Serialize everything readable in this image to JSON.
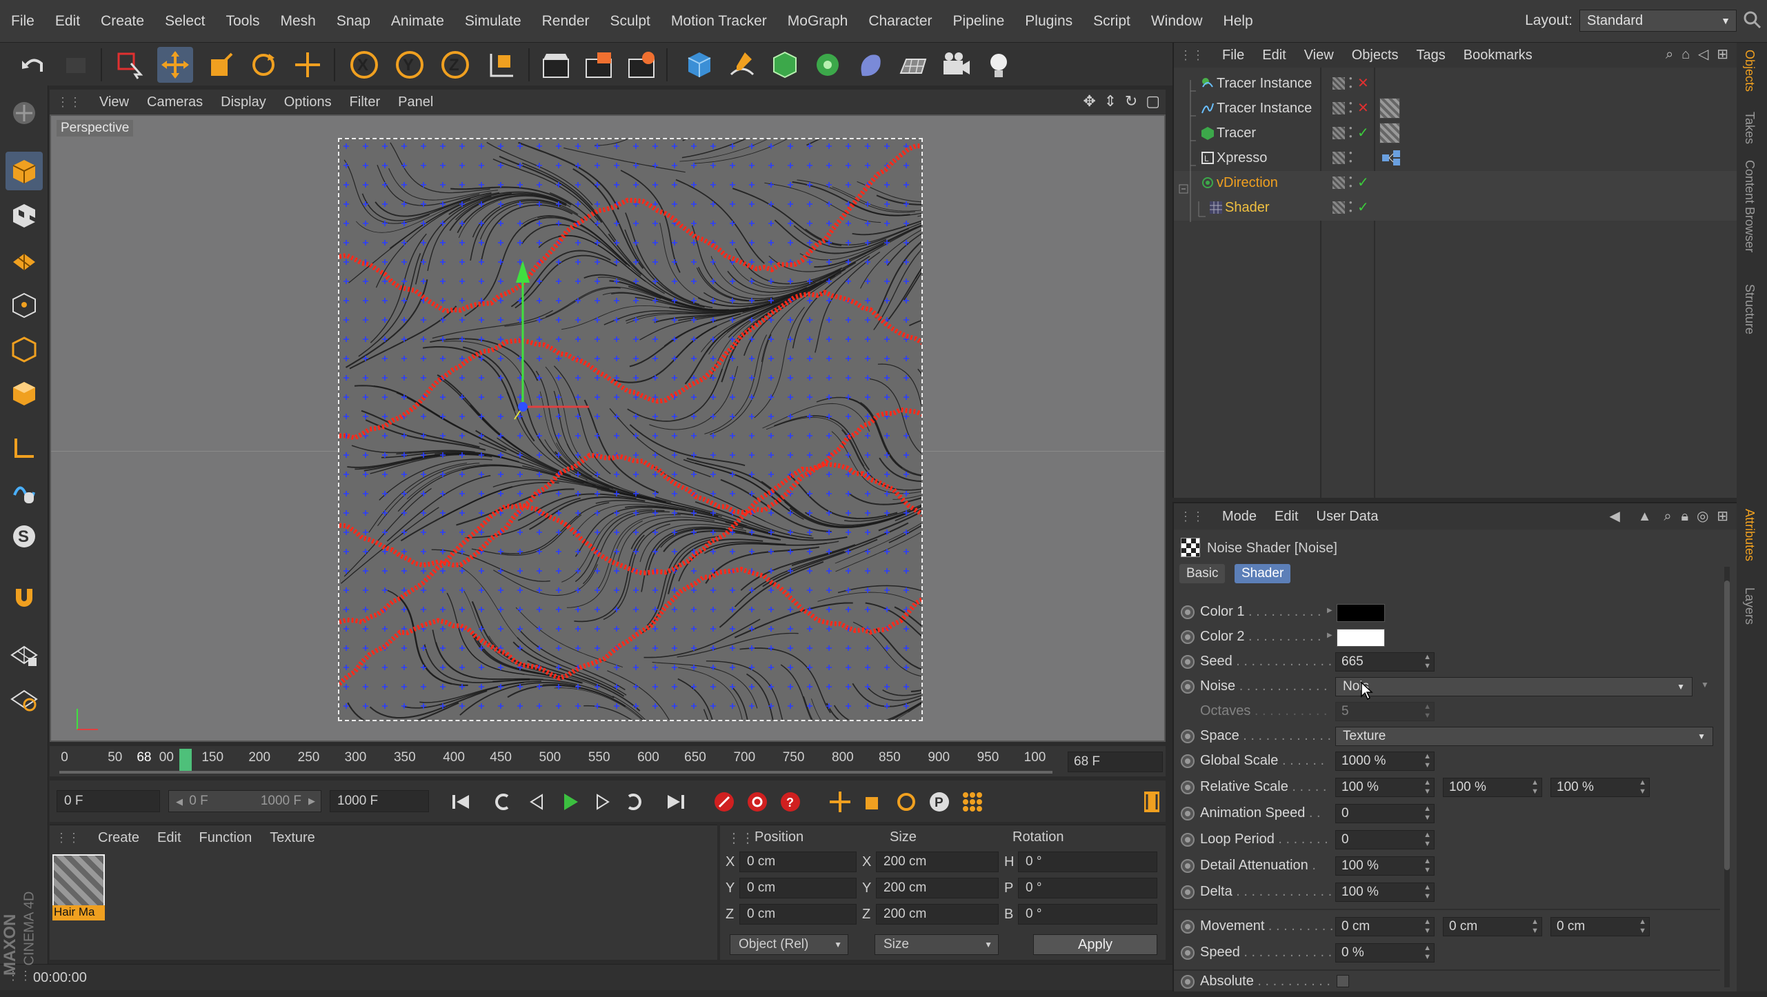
{
  "menubar": {
    "items": [
      "File",
      "Edit",
      "Create",
      "Select",
      "Tools",
      "Mesh",
      "Snap",
      "Animate",
      "Simulate",
      "Render",
      "Sculpt",
      "Motion Tracker",
      "MoGraph",
      "Character",
      "Pipeline",
      "Plugins",
      "Script",
      "Window",
      "Help"
    ],
    "layout_label": "Layout:",
    "layout_value": "Standard"
  },
  "viewport": {
    "menu": [
      "View",
      "Cameras",
      "Display",
      "Options",
      "Filter",
      "Panel"
    ],
    "label": "Perspective"
  },
  "timeline": {
    "ticks": [
      "0",
      "50",
      "68",
      "00",
      "150",
      "200",
      "250",
      "300",
      "350",
      "400",
      "450",
      "500",
      "550",
      "600",
      "650",
      "700",
      "750",
      "800",
      "850",
      "900",
      "950",
      "100"
    ],
    "current_frame": "68 F"
  },
  "transport": {
    "start_field": "0 F",
    "range_start": "0 F",
    "range_end": "1000 F",
    "end_field": "1000 F"
  },
  "material_manager": {
    "menu": [
      "Create",
      "Edit",
      "Function",
      "Texture"
    ],
    "material_name": "Hair Ma"
  },
  "coordinates": {
    "headers": {
      "position": "Position",
      "size": "Size",
      "rotation": "Rotation"
    },
    "rows": [
      {
        "axis": "X",
        "position": "0 cm",
        "size_axis": "X",
        "size": "200 cm",
        "rot_axis": "H",
        "rotation": "0 °"
      },
      {
        "axis": "Y",
        "position": "0 cm",
        "size_axis": "Y",
        "size": "200 cm",
        "rot_axis": "P",
        "rotation": "0 °"
      },
      {
        "axis": "Z",
        "position": "0 cm",
        "size_axis": "Z",
        "size": "200 cm",
        "rot_axis": "B",
        "rotation": "0 °"
      }
    ],
    "mode_dropdown": "Object (Rel)",
    "size_dropdown": "Size",
    "apply_label": "Apply"
  },
  "status": {
    "time": "00:00:00"
  },
  "logo": {
    "line1": "MAXON",
    "line2": "CINEMA 4D"
  },
  "objects_manager": {
    "menu": [
      "File",
      "Edit",
      "View",
      "Objects",
      "Tags",
      "Bookmarks"
    ],
    "objects": [
      {
        "name": "Tracer Instance",
        "color": "#d8d8d8"
      },
      {
        "name": "Tracer Instance",
        "color": "#d8d8d8"
      },
      {
        "name": "Tracer",
        "color": "#d8d8d8"
      },
      {
        "name": "Xpresso",
        "color": "#d8d8d8"
      },
      {
        "name": "vDirection",
        "color": "#f0a020"
      },
      {
        "name": "Shader",
        "color": "#f0c040"
      }
    ]
  },
  "attributes_manager": {
    "menu": [
      "Mode",
      "Edit",
      "User Data"
    ],
    "title": "Noise Shader [Noise]",
    "tabs": [
      "Basic",
      "Shader"
    ],
    "active_tab": "Shader",
    "rows": {
      "color1": {
        "label": "Color 1",
        "dots": " . . . . . . . . . ."
      },
      "color2": {
        "label": "Color 2",
        "dots": " . . . . . . . . . ."
      },
      "seed": {
        "label": "Seed",
        "dots": " . . . . . . . . . . . . .",
        "value": "665"
      },
      "noise": {
        "label": "Noise",
        "dots": " . . . . . . . . . . . .",
        "value": "Nois"
      },
      "octaves": {
        "label": "Octaves",
        "dots": " . . . . . . . . . .",
        "value": "5"
      },
      "space": {
        "label": "Space",
        "dots": " . . . . . . . . . . . .",
        "value": "Texture"
      },
      "global_scale": {
        "label": "Global Scale",
        "dots": " . . . . . .",
        "value": "1000 %"
      },
      "relative_scale": {
        "label": "Relative Scale",
        "dots": " . . . . .",
        "values": [
          "100 %",
          "100 %",
          "100 %"
        ]
      },
      "animation_speed": {
        "label": "Animation Speed",
        "dots": " . .",
        "value": "0"
      },
      "loop_period": {
        "label": "Loop Period",
        "dots": " . . . . . . .",
        "value": "0"
      },
      "detail_attenuation": {
        "label": "Detail Attenuation",
        "dots": " .",
        "value": "100 %"
      },
      "delta": {
        "label": "Delta",
        "dots": " . . . . . . . . . . . . .",
        "value": "100 %"
      },
      "movement": {
        "label": "Movement",
        "dots": " . . . . . . . . .",
        "values": [
          "0 cm",
          "0 cm",
          "0 cm"
        ]
      },
      "speed": {
        "label": "Speed",
        "dots": " . . . . . . . . . . . .",
        "value": "0 %"
      },
      "absolute": {
        "label": "Absolute",
        "dots": " . . . . . . . . . ."
      }
    }
  },
  "side_tabs": [
    "Objects",
    "Takes",
    "Content Browser",
    "Structure",
    "Attributes",
    "Layers"
  ],
  "colors": {
    "accent": "#f0a020",
    "active_tab": "#5c7fb8",
    "trail_red": "#ff2a1a",
    "marker_blue": "#2a3cff"
  }
}
